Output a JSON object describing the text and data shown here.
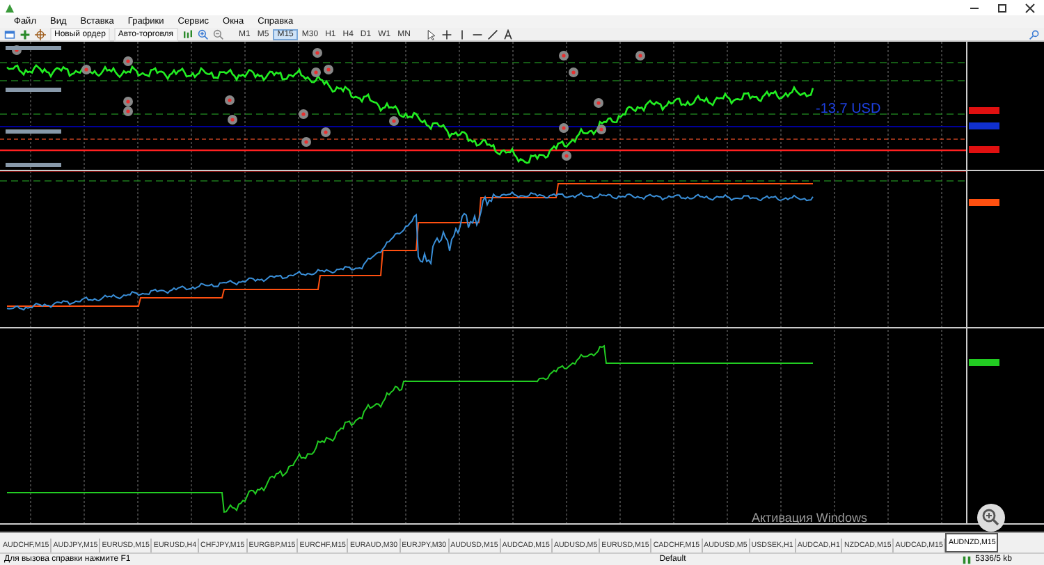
{
  "menu": [
    "Файл",
    "Вид",
    "Вставка",
    "Графики",
    "Сервис",
    "Окна",
    "Справка"
  ],
  "toolbar": {
    "buttons": [
      {
        "label": "Новый ордер"
      },
      {
        "label": "Авто-торговля"
      }
    ],
    "timeframes": [
      {
        "label": "M1",
        "selected": false
      },
      {
        "label": "M5",
        "selected": false
      },
      {
        "label": "M15",
        "selected": true
      },
      {
        "label": "M30",
        "selected": false
      },
      {
        "label": "H1",
        "selected": false
      },
      {
        "label": "H4",
        "selected": false
      },
      {
        "label": "D1",
        "selected": false
      },
      {
        "label": "W1",
        "selected": false
      },
      {
        "label": "MN",
        "selected": false
      }
    ]
  },
  "chart": {
    "profit_label": "-13.7 USD",
    "activation_notice": "Активация Windows"
  },
  "chart_tabs": [
    {
      "label": "AUDCHF,M15",
      "selected": false
    },
    {
      "label": "AUDJPY,M15",
      "selected": false
    },
    {
      "label": "EURUSD,M15",
      "selected": false
    },
    {
      "label": "EURUSD,H4",
      "selected": false
    },
    {
      "label": "CHFJPY,M15",
      "selected": false
    },
    {
      "label": "EURGBP,M15",
      "selected": false
    },
    {
      "label": "EURCHF,M15",
      "selected": false
    },
    {
      "label": "EURAUD,M30",
      "selected": false
    },
    {
      "label": "EURJPY,M30",
      "selected": false
    },
    {
      "label": "AUDUSD,M15",
      "selected": false
    },
    {
      "label": "AUDCAD,M15",
      "selected": false
    },
    {
      "label": "AUDUSD,M5",
      "selected": false
    },
    {
      "label": "EURUSD,M15",
      "selected": false
    },
    {
      "label": "CADCHF,M15",
      "selected": false
    },
    {
      "label": "AUDUSD,M5",
      "selected": false
    },
    {
      "label": "USDSEK,H1",
      "selected": false
    },
    {
      "label": "AUDCAD,H1",
      "selected": false
    },
    {
      "label": "NZDCAD,M15",
      "selected": false
    },
    {
      "label": "AUDCAD,M15",
      "selected": false
    },
    {
      "label": "AUDNZD,M15",
      "selected": true
    }
  ],
  "status_bar": {
    "hint": "Для вызова справки нажмите F1",
    "profile": "Default",
    "traffic": "5336/5 kb"
  }
}
